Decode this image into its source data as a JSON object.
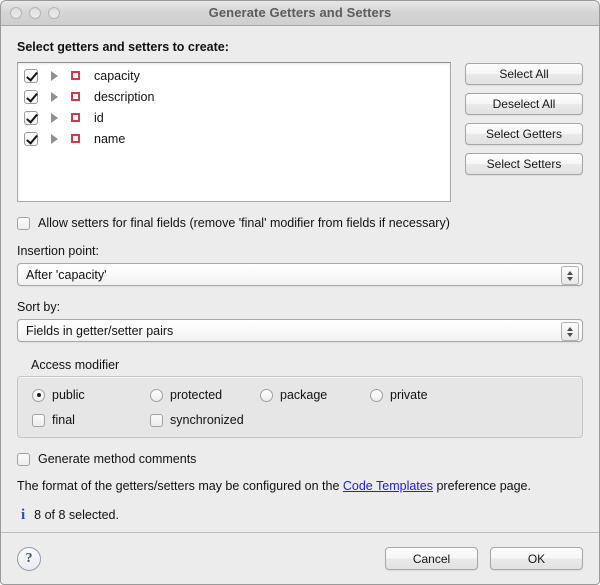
{
  "window": {
    "title": "Generate Getters and Setters",
    "traffic_lights": [
      "close-button",
      "minimize-button",
      "zoom-button"
    ]
  },
  "main": {
    "list_heading": "Select getters and setters to create:",
    "fields": [
      {
        "name": "capacity",
        "checked": true,
        "icon": "field-icon",
        "disclosure": "collapsed-arrow-icon"
      },
      {
        "name": "description",
        "checked": true,
        "icon": "field-icon",
        "disclosure": "collapsed-arrow-icon"
      },
      {
        "name": "id",
        "checked": true,
        "icon": "field-icon",
        "disclosure": "collapsed-arrow-icon"
      },
      {
        "name": "name",
        "checked": true,
        "icon": "field-icon",
        "disclosure": "collapsed-arrow-icon"
      }
    ],
    "side_buttons": [
      {
        "label": "Select All"
      },
      {
        "label": "Deselect All"
      },
      {
        "label": "Select Getters"
      },
      {
        "label": "Select Setters"
      }
    ],
    "allow_final": {
      "label": "Allow setters for final fields (remove 'final' modifier from fields if necessary)",
      "checked": false
    },
    "insertion_point": {
      "label": "Insertion point:",
      "value": "After 'capacity'"
    },
    "sort_by": {
      "label": "Sort by:",
      "value": "Fields in getter/setter pairs"
    },
    "access_modifier": {
      "title": "Access modifier",
      "radios": [
        {
          "label": "public",
          "selected": true
        },
        {
          "label": "protected",
          "selected": false
        },
        {
          "label": "package",
          "selected": false
        },
        {
          "label": "private",
          "selected": false
        }
      ],
      "checkboxes": [
        {
          "label": "final",
          "checked": false
        },
        {
          "label": "synchronized",
          "checked": false
        }
      ]
    },
    "generate_comments": {
      "label": "Generate method comments",
      "checked": false
    },
    "note": {
      "prefix": "The format of the getters/setters may be configured on the ",
      "link": "Code Templates",
      "suffix": " preference page."
    },
    "status": {
      "icon": "info-icon",
      "text": "8 of 8 selected."
    }
  },
  "footer": {
    "help_label": "?",
    "cancel_label": "Cancel",
    "ok_label": "OK"
  },
  "colors": {
    "background": "#ececec",
    "link": "#2222cc",
    "info": "#2b4fb0",
    "field_icon": "#cf3a4c"
  }
}
